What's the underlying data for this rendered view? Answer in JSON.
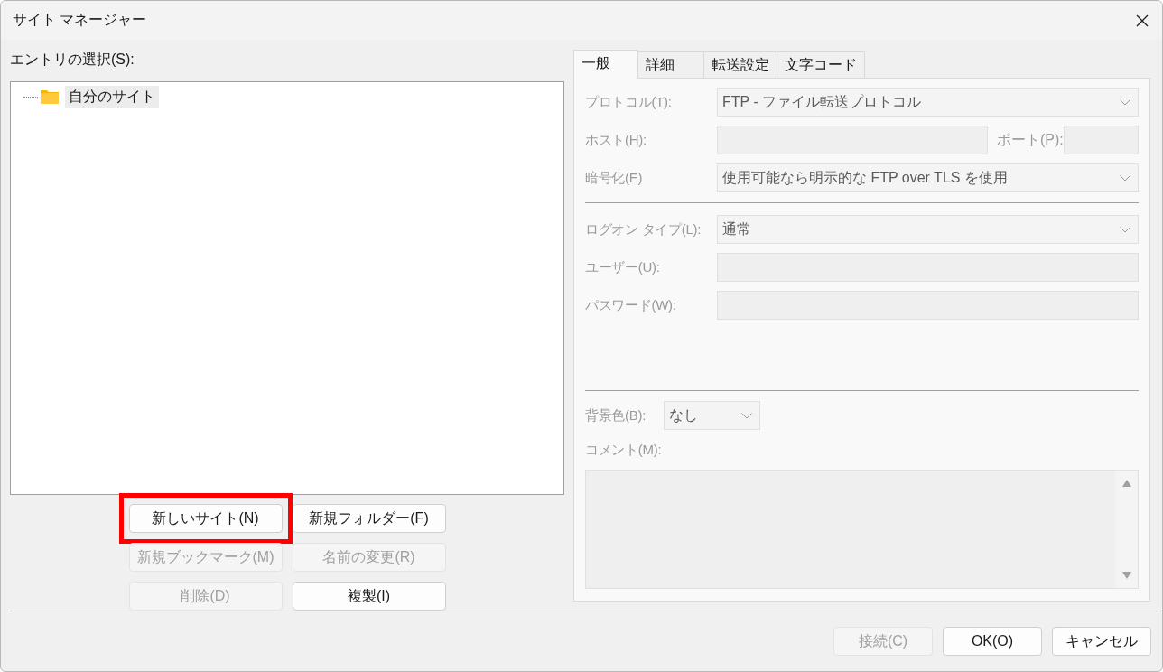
{
  "window": {
    "title": "サイト マネージャー"
  },
  "entries": {
    "label": "エントリの選択(S):",
    "tree": [
      {
        "label": "自分のサイト",
        "selected": true
      }
    ]
  },
  "entry_buttons": [
    {
      "label": "新しいサイト(N)",
      "disabled": false,
      "highlighted": true
    },
    {
      "label": "新規フォルダー(F)",
      "disabled": false,
      "highlighted": false
    },
    {
      "label": "新規ブックマーク(M)",
      "disabled": true,
      "highlighted": false
    },
    {
      "label": "名前の変更(R)",
      "disabled": true,
      "highlighted": false
    },
    {
      "label": "削除(D)",
      "disabled": true,
      "highlighted": false
    },
    {
      "label": "複製(I)",
      "disabled": false,
      "highlighted": false
    }
  ],
  "tabs": [
    {
      "label": "一般",
      "selected": true
    },
    {
      "label": "詳細",
      "selected": false
    },
    {
      "label": "転送設定",
      "selected": false
    },
    {
      "label": "文字コード",
      "selected": false
    }
  ],
  "general": {
    "disabled": true,
    "fields": [
      {
        "kind": "select",
        "label": "プロトコル(T):",
        "value": "FTP - ファイル転送プロトコル"
      },
      {
        "kind": "host",
        "label": "ホスト(H):",
        "port_label": "ポート(P):"
      },
      {
        "kind": "select",
        "label": "暗号化(E)",
        "value": "使用可能なら明示的な FTP over TLS を使用"
      },
      {
        "kind": "separator"
      },
      {
        "kind": "select",
        "label": "ログオン タイプ(L):",
        "value": "通常"
      },
      {
        "kind": "input",
        "label": "ユーザー(U):"
      },
      {
        "kind": "input",
        "label": "パスワード(W):"
      }
    ],
    "background": {
      "label": "背景色(B):",
      "value": "なし"
    },
    "comment": {
      "label": "コメント(M):"
    }
  },
  "dialog_buttons": [
    {
      "label": "接続(C)",
      "disabled": true
    },
    {
      "label": "OK(O)",
      "disabled": false
    },
    {
      "label": "キャンセル",
      "disabled": false
    }
  ]
}
